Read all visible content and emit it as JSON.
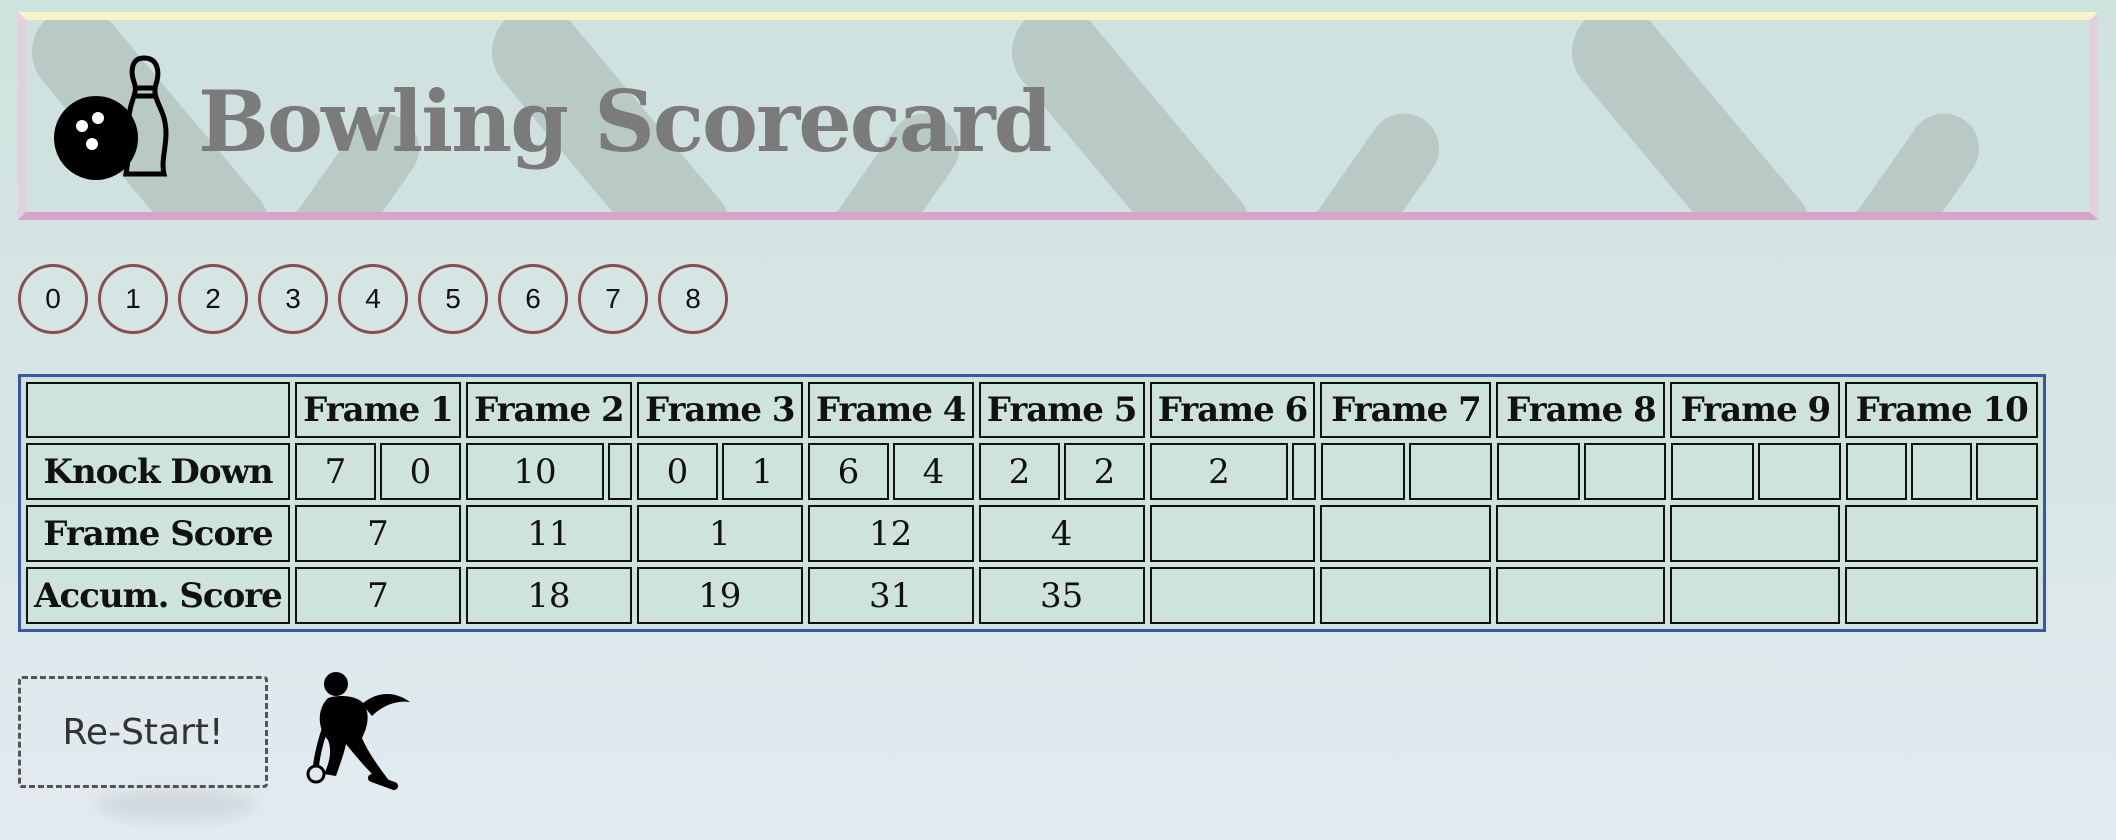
{
  "header": {
    "title": "Bowling Scorecard",
    "icon": "bowling-ball-and-pin-icon"
  },
  "pin_buttons": [
    "0",
    "1",
    "2",
    "3",
    "4",
    "5",
    "6",
    "7",
    "8"
  ],
  "scorecard": {
    "headers": [
      "Frame 1",
      "Frame 2",
      "Frame 3",
      "Frame 4",
      "Frame 5",
      "Frame 6",
      "Frame 7",
      "Frame 8",
      "Frame 9",
      "Frame 10"
    ],
    "row_labels": {
      "knock_down": "Knock Down",
      "frame_score": "Frame Score",
      "accum_score": "Accum. Score"
    },
    "knock_down": [
      [
        "7",
        "0"
      ],
      [
        "10",
        ""
      ],
      [
        "0",
        "1"
      ],
      [
        "6",
        "4"
      ],
      [
        "2",
        "2"
      ],
      [
        "2",
        ""
      ],
      [
        "",
        ""
      ],
      [
        "",
        ""
      ],
      [
        "",
        ""
      ],
      [
        "",
        "",
        ""
      ]
    ],
    "frame_score": [
      "7",
      "11",
      "1",
      "12",
      "4",
      "",
      "",
      "",
      "",
      ""
    ],
    "accum_score": [
      "7",
      "18",
      "19",
      "31",
      "35",
      "",
      "",
      "",
      "",
      ""
    ]
  },
  "restart_label": "Re-Start!",
  "icons": {
    "bowler": "bowler-icon"
  },
  "colors": {
    "pin_button_border": "#8a4f52",
    "table_border": "#3b56a3",
    "title": "#7b7b7b"
  }
}
